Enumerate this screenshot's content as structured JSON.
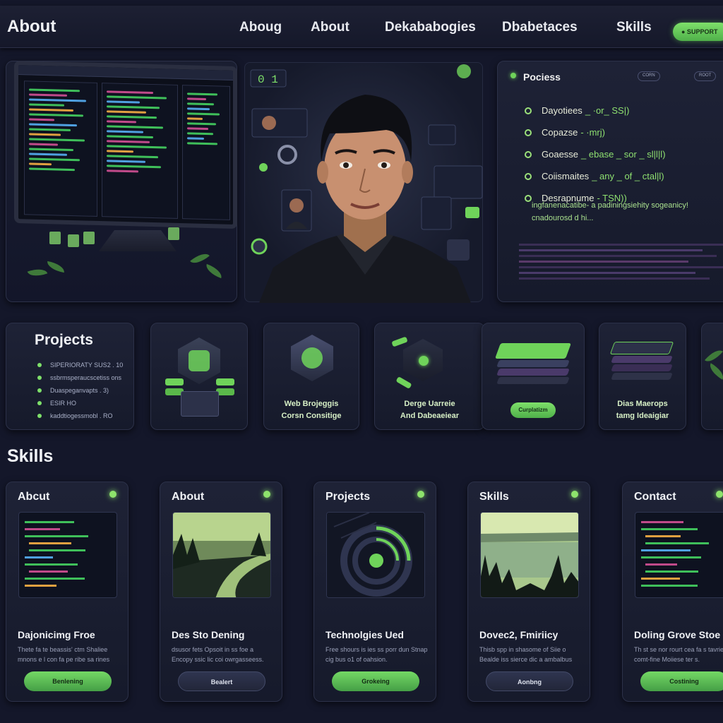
{
  "nav": {
    "brand": "About",
    "links": [
      "Aboug",
      "About",
      "Dekababogies",
      "Dbabetaces",
      "Skills"
    ],
    "cta": "● SUPPORT"
  },
  "process": {
    "title": "Pociess",
    "pills": [
      "CORN",
      "ROOT"
    ],
    "items": [
      {
        "text": "Dayotiees",
        "code": "_ ·or_ SS|)"
      },
      {
        "text": "Copazse",
        "code": "- ·mrj)"
      },
      {
        "text": "Goaesse",
        "code": "_ ebase _ sor _ sl|l|l)"
      },
      {
        "text": "Coiismaites",
        "code": "_ any _ of _ ctal|l)"
      },
      {
        "text": "Desrapnume",
        "code": "- TSN))"
      }
    ],
    "subtext": "ingfanenacatibe- a padiningsiehity sogeanicy! cnadourosd d hi..."
  },
  "projects": {
    "title": "Projects",
    "items": [
      "SIPERIORATY SUS2 . 10",
      "ssbrmsperaucscetiss ons",
      "Duaspeganvapts . 3)",
      "ESIR HO",
      "kaddtiogessmobl . RO"
    ],
    "cards": [
      {
        "caption": [
          "",
          ""
        ]
      },
      {
        "caption": [
          "Web Brojeggis",
          "Corsn Consitige"
        ]
      },
      {
        "caption": [
          "Derge Uarreie",
          "And Dabeaeiear"
        ]
      },
      {
        "caption": [
          "",
          ""
        ],
        "button": "Curplatizm"
      },
      {
        "caption": [
          "Dias Maerops",
          "tamg Ideaigiar"
        ]
      }
    ]
  },
  "skills": {
    "title": "Skills",
    "cards": [
      {
        "header": "Abcut",
        "title": "Dajonicimg Froe",
        "desc": "Thete fa te beassis' ctm Shaliee mnons e l con fa pe ribe sa rines",
        "button": "Benlening",
        "dark": false
      },
      {
        "header": "About",
        "title": "Des Sto Dening",
        "desc": "dsusor fets Opsoit in ss foe a Encopy ssic lic coi owrgasseess.",
        "button": "Bealert",
        "dark": true
      },
      {
        "header": "Projects",
        "title": "Technolgies Ued",
        "desc": "Free shours is ies ss porr dun Stnap cig bus o1 of oahsion.",
        "button": "Grokeing",
        "dark": false
      },
      {
        "header": "Skills",
        "title": "Dovec2, Fmiriicy",
        "desc": "Thisb spp in shasome of Siie o Bealde iss sierce dic a ambalbus",
        "button": "Aonbng",
        "dark": true
      },
      {
        "header": "Contact",
        "title": "Doling Grove Stoe",
        "desc": "Th st se nor rourt cea fa s tavries comt-fine Moiiese ter s.",
        "button": "Costining",
        "dark": false
      }
    ]
  },
  "colors": {
    "accent": "#7ee06a",
    "bg": "#14172a",
    "panel": "#1e2236"
  },
  "icons": [
    "monitor-icon",
    "avatar",
    "hex-badge-icon",
    "book-stack-icon",
    "leaf-icon"
  ]
}
